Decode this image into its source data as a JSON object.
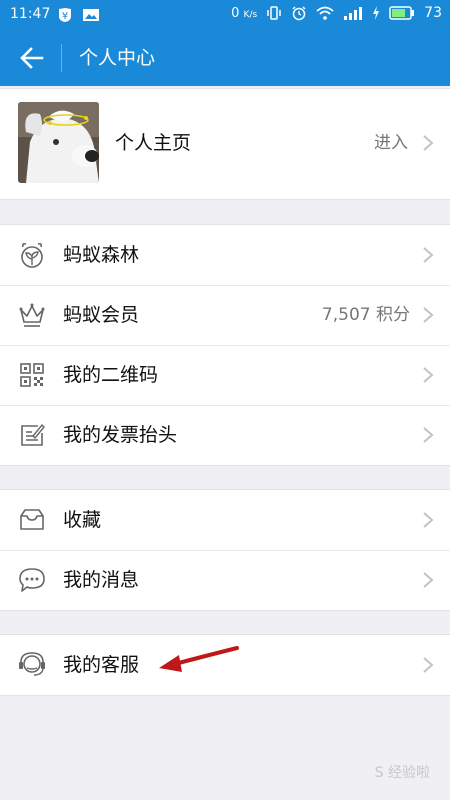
{
  "status_bar": {
    "time": "11:47",
    "network_speed": "0",
    "network_unit": "K/s",
    "battery": "73",
    "icons": [
      "alipay-icon",
      "image-icon",
      "vibrate-icon",
      "alarm-icon",
      "wifi-icon",
      "signal-icon",
      "charging-icon",
      "battery-icon"
    ]
  },
  "header": {
    "title": "个人中心",
    "back_icon": "back-arrow-icon"
  },
  "profile": {
    "label": "个人主页",
    "action": "进入"
  },
  "menu_group_1": [
    {
      "label": "蚂蚁森林",
      "icon": "forest-sprout-icon",
      "value": ""
    },
    {
      "label": "蚂蚁会员",
      "icon": "crown-icon",
      "value": "7,507 积分"
    },
    {
      "label": "我的二维码",
      "icon": "qrcode-icon",
      "value": ""
    },
    {
      "label": "我的发票抬头",
      "icon": "invoice-edit-icon",
      "value": ""
    }
  ],
  "menu_group_2": [
    {
      "label": "收藏",
      "icon": "inbox-tray-icon",
      "value": ""
    },
    {
      "label": "我的消息",
      "icon": "chat-bubble-icon",
      "value": ""
    }
  ],
  "menu_group_3": [
    {
      "label": "我的客服",
      "icon": "headset-service-icon",
      "value": ""
    }
  ],
  "annotation": {
    "arrow_color": "#c0171b"
  },
  "colors": {
    "primary": "#1a8ad8",
    "background": "#efeff4",
    "icon_gray": "#666666"
  },
  "watermark": {
    "text": "S 经验啦"
  }
}
